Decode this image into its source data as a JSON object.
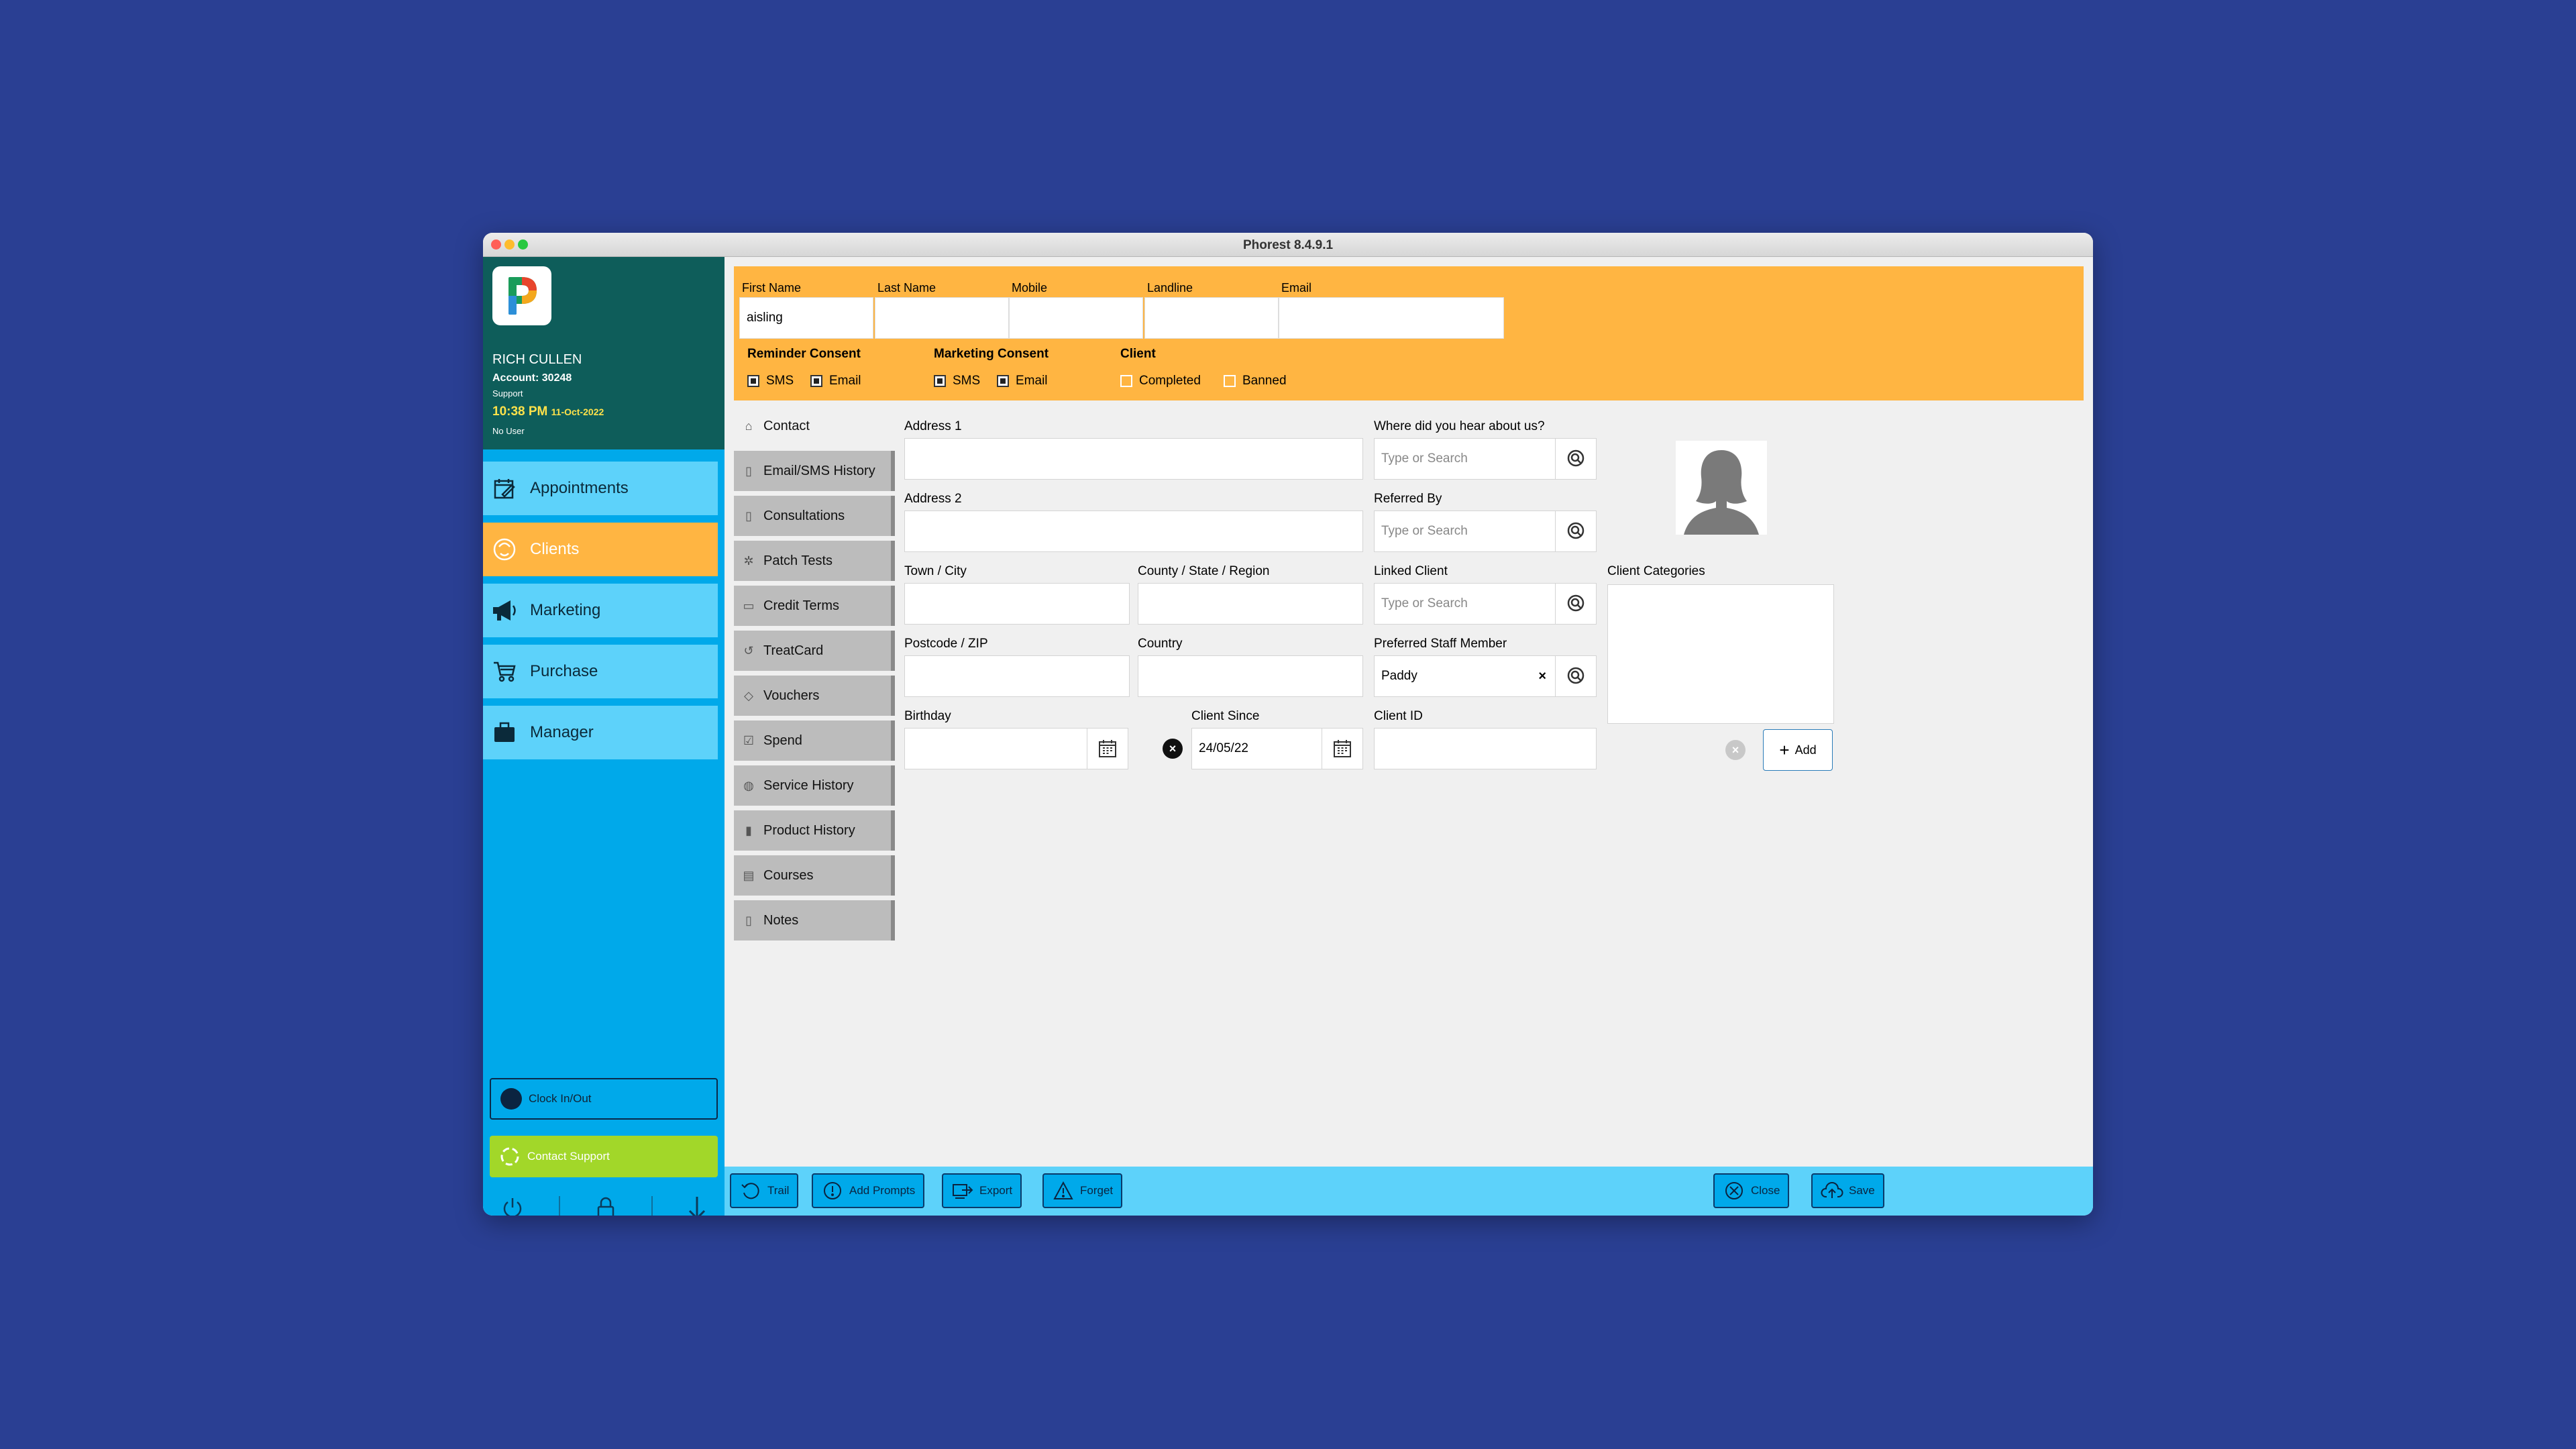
{
  "window": {
    "title": "Phorest 8.4.9.1"
  },
  "user": {
    "name": "RICH CULLEN",
    "account": "Account: 30248",
    "role": "Support",
    "time": "10:38 PM",
    "date": "11-Oct-2022",
    "status": "No User"
  },
  "nav": {
    "appointments": "Appointments",
    "clients": "Clients",
    "marketing": "Marketing",
    "purchase": "Purchase",
    "manager": "Manager",
    "clock": "Clock In/Out",
    "support": "Contact Support"
  },
  "header": {
    "first_name_label": "First Name",
    "last_name_label": "Last Name",
    "mobile_label": "Mobile",
    "landline_label": "Landline",
    "email_label": "Email",
    "first_name_value": "aisling",
    "reminder_label": "Reminder Consent",
    "marketing_label": "Marketing Consent",
    "client_label": "Client",
    "sms": "SMS",
    "email": "Email",
    "completed": "Completed",
    "banned": "Banned"
  },
  "tabs": {
    "contact": "Contact",
    "email_sms": "Email/SMS History",
    "consultations": "Consultations",
    "patch": "Patch Tests",
    "credit": "Credit Terms",
    "treatcard": "TreatCard",
    "vouchers": "Vouchers",
    "spend": "Spend",
    "service": "Service History",
    "product": "Product History",
    "courses": "Courses",
    "notes": "Notes"
  },
  "form": {
    "address1": "Address 1",
    "address2": "Address 2",
    "town": "Town / City",
    "county": "County / State / Region",
    "postcode": "Postcode / ZIP",
    "country": "Country",
    "birthday": "Birthday",
    "client_since": "Client Since",
    "client_since_value": "24/05/22",
    "hear": "Where did you hear about us?",
    "referred": "Referred By",
    "linked": "Linked Client",
    "staff": "Preferred Staff Member",
    "staff_value": "Paddy",
    "client_id": "Client ID",
    "search_placeholder": "Type or Search",
    "categories": "Client Categories",
    "add": "Add"
  },
  "toolbar": {
    "trail": "Trail",
    "prompts": "Add Prompts",
    "export": "Export",
    "forget": "Forget",
    "close": "Close",
    "save": "Save"
  },
  "icons": [
    "calendar-edit-icon",
    "face-icon",
    "megaphone-icon",
    "cart-icon",
    "briefcase-icon",
    "search-icon",
    "calendar-icon",
    "power-icon",
    "lock-icon",
    "arrow-down-icon"
  ],
  "colors": {
    "background": "#2a3f93",
    "sidebar": "#00a9ea",
    "nav_button": "#5dd2fa",
    "accent_orange": "#ffb542",
    "user_panel": "#0e5d5a",
    "support_green": "#a2d729"
  }
}
